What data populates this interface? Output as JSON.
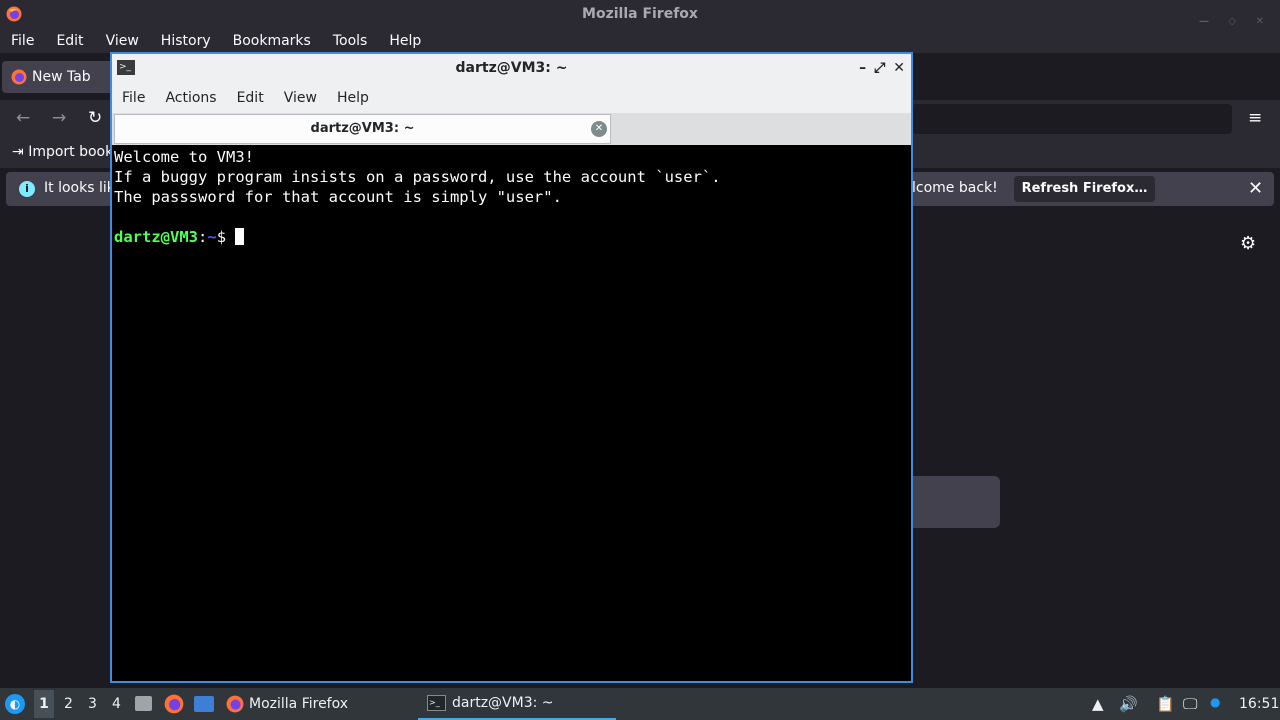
{
  "firefox": {
    "window_title": "Mozilla Firefox",
    "menu": [
      "File",
      "Edit",
      "View",
      "History",
      "Bookmarks",
      "Tools",
      "Help"
    ],
    "tab_label": "New Tab",
    "import_bookmarks": "Import book",
    "notification_text": "It looks lik",
    "notification_tail": "lcome back!",
    "refresh_button": "Refresh Firefox…"
  },
  "terminal": {
    "window_title": "dartz@VM3: ~",
    "menu": [
      "File",
      "Actions",
      "Edit",
      "View",
      "Help"
    ],
    "tab_label": "dartz@VM3: ~",
    "lines": [
      "Welcome to VM3!",
      "If a buggy program insists on a password, use the account `user`.",
      "The passsword for that account is simply \"user\"."
    ],
    "prompt_user": "dartz@VM3",
    "prompt_sep": ":",
    "prompt_path": "~",
    "prompt_symbol": "$"
  },
  "taskbar": {
    "workspaces": [
      "1",
      "2",
      "3",
      "4"
    ],
    "tasks": [
      {
        "label": "Mozilla Firefox"
      },
      {
        "label": "dartz@VM3: ~"
      }
    ],
    "clock": "16:51"
  },
  "colors": {
    "accent": "#3e8de0",
    "prompt_user": "#54ff54",
    "prompt_path": "#5454ff",
    "taskbar_bg": "#31363b"
  }
}
